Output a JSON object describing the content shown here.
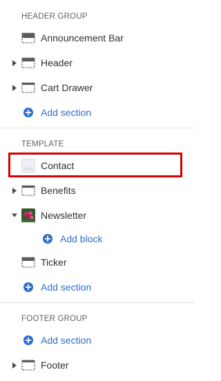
{
  "groups": {
    "header": {
      "title": "HEADER GROUP",
      "items": [
        {
          "label": "Announcement Bar",
          "icon": "section-full-icon"
        },
        {
          "label": "Header",
          "icon": "section-header-icon"
        },
        {
          "label": "Cart Drawer",
          "icon": "section-dashed-icon"
        }
      ],
      "add_label": "Add section"
    },
    "template": {
      "title": "TEMPLATE",
      "items": [
        {
          "label": "Contact",
          "icon": "image-thumbnail-icon",
          "selected": true
        },
        {
          "label": "Benefits",
          "icon": "section-dashed-icon"
        },
        {
          "label": "Newsletter",
          "icon": "photo-thumbnail-icon",
          "expanded": true
        },
        {
          "label": "Ticker",
          "icon": "section-header-icon"
        }
      ],
      "add_block_label": "Add block",
      "add_label": "Add section"
    },
    "footer": {
      "title": "FOOTER GROUP",
      "add_label": "Add section",
      "items": [
        {
          "label": "Footer",
          "icon": "section-dashed-icon"
        }
      ]
    }
  },
  "colors": {
    "accent": "#2c6ecb",
    "highlight_border": "#d10000",
    "divider": "#e3e3e3",
    "muted_text": "#616161"
  }
}
